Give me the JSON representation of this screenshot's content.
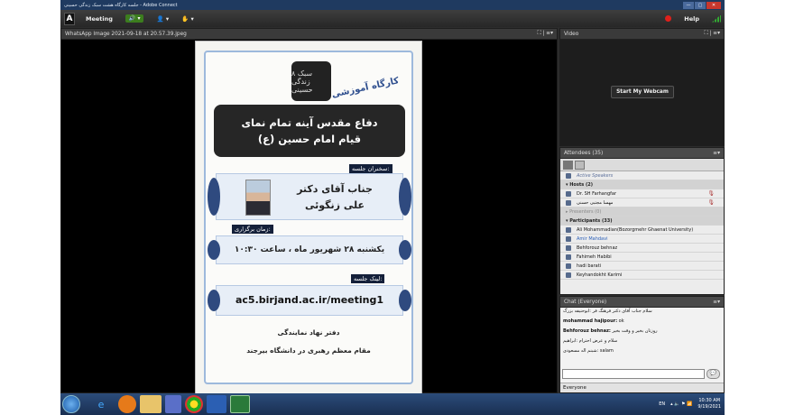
{
  "window": {
    "title": "جلسه کارگاه هشت سبک زندگی حسینی - Adobe Connect",
    "min": "—",
    "max": "▢",
    "close": "✕"
  },
  "menubar": {
    "logo": "A",
    "meeting": "Meeting",
    "speaker": "🔊 ▾",
    "people": "👤 ▾",
    "hand": "✋ ▾",
    "help": "Help"
  },
  "share": {
    "title": "WhatsApp Image 2021-09-18 at 20.57.39.jpeg",
    "fit": "⛶ |",
    "menu": "≡▾"
  },
  "slide": {
    "logo_text": "۸ سبک زندگی حسینی",
    "workshop": "کارگاه آموزشی",
    "banner_line1": "دفاع مقدس آینه تمام نمای",
    "banner_line2": "قیام امام حسین (ع)",
    "speaker_label": "سخنران جلسه:",
    "speaker_line1": "جناب آقای دکتر",
    "speaker_line2": "علی زنگوئی",
    "time_label": "زمان برگزاری:",
    "time_value": "یکشنبه ۲۸ شهریور ماه ، ساعت ۱۰:۳۰",
    "link_label": "لینک جلسه:",
    "link_value": "ac5.birjand.ac.ir/meeting1",
    "office1": "دفتر نهاد نمایندگی",
    "office2": "مقام معظم رهبری در دانشگاه بیرجند"
  },
  "video": {
    "title": "Video",
    "fit": "⛶ |",
    "menu": "≡▾",
    "webcam_button": "Start My Webcam"
  },
  "attendees": {
    "title": "Attendees (35)",
    "menu": "≡▾",
    "active_speakers": "Active Speakers",
    "hosts_header": "▾ Hosts (2)",
    "hosts": [
      "Dr. SH Farhangfar",
      "مهسا مجتبی حسنی"
    ],
    "presenters_header": "▸ Presenters (0)",
    "participants_header": "▾ Participants (33)",
    "participants": [
      "Ali Mohammadian(Bozorgmehr Ghaenat University)",
      "Amir Mahdavi",
      "Behforouz behnaz",
      "Fahimeh Habibi",
      "hadi barati",
      "Keyhandokht Karimi"
    ]
  },
  "chat": {
    "title": "Chat (Everyone)",
    "menu": "≡▾",
    "messages": [
      {
        "who": "",
        "text": "سلام جناب آقای دکتر فرهنگ فر :ابوحنیفه بزرگ"
      },
      {
        "who": "mohammad hajipour:",
        "text": " ok"
      },
      {
        "who": "Behforouz behnaz:",
        "text": " روزتان بخیر و وقت بخیر"
      },
      {
        "who": "",
        "text": "سلام و عرض احترام :ابراهیم"
      },
      {
        "who": "",
        "text": "شبنم اله مسعودی: salam"
      }
    ],
    "send": "💬",
    "recipient": "Everyone"
  },
  "taskbar": {
    "tray_lang": "EN",
    "tray_icons": "▴ 🔈 ⚑ 📶",
    "time": "10:30 AM",
    "date": "9/19/2021"
  }
}
